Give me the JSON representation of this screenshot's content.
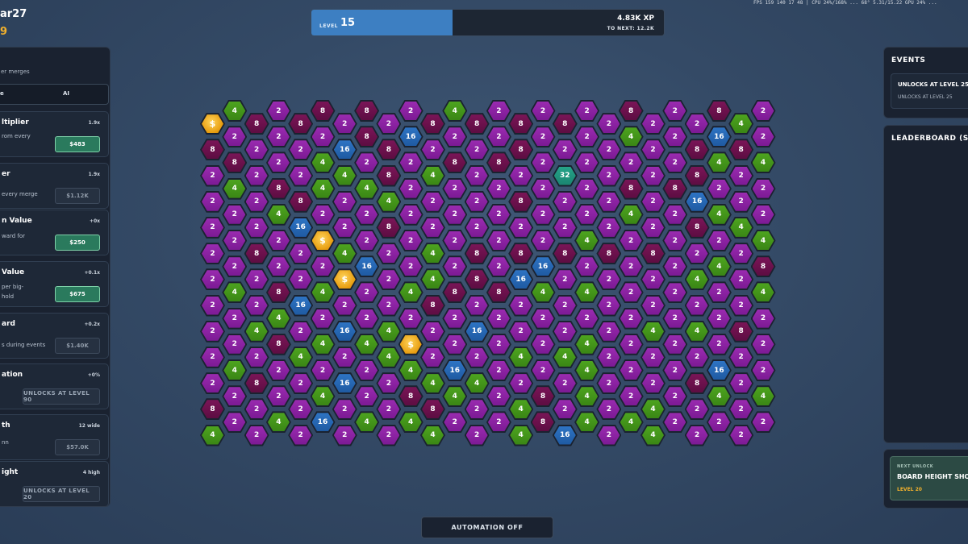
{
  "player": {
    "name": "ar27",
    "coins": "9"
  },
  "perf": "FPS 159 140 17 48  |  CPU 24%/168%  ...  68°  5.31/15.22  GPU 24%  ...",
  "level": {
    "label": "LEVEL",
    "value": "15",
    "xp": "4.83K XP",
    "to_next": "TO NEXT: 12.2K",
    "progress": 0.4
  },
  "left_panel": {
    "description": "er merges",
    "mode_tabs": [
      "e",
      "AI"
    ],
    "upgrades": [
      {
        "title": "ltiplier",
        "stat": "1.9x",
        "lines": [
          "rom every"
        ],
        "button": "$483",
        "affordable": true
      },
      {
        "title": "er",
        "stat": "1.9x",
        "lines": [
          "every merge"
        ],
        "button": "$1.12K",
        "affordable": false
      },
      {
        "title": "n Value",
        "stat": "+0x",
        "lines": [
          "ward for"
        ],
        "button": "$250",
        "affordable": true
      },
      {
        "title": "Value",
        "stat": "+0.1x",
        "lines": [
          "per big-",
          "hold"
        ],
        "button": "$675",
        "affordable": true
      },
      {
        "title": "ard",
        "stat": "+0.2x",
        "lines": [
          "s during events"
        ],
        "button": "$1.40K",
        "affordable": false
      },
      {
        "title": "ation",
        "stat": "+0%",
        "lines": [],
        "button": "UNLOCKS AT LEVEL 90",
        "locked": true
      },
      {
        "title": "th",
        "stat": "12 wide",
        "lines": [
          "nn"
        ],
        "button": "$57.0K",
        "affordable": false
      },
      {
        "title": "ight",
        "stat": "4 high",
        "lines": [],
        "button": "UNLOCKS AT LEVEL 20",
        "locked": true
      }
    ]
  },
  "events": {
    "title": "EVENTS",
    "card_title": "UNLOCKS AT LEVEL 25",
    "card_sub": "UNLOCKS AT LEVEL 25"
  },
  "leaderboard": {
    "title": "LEADERBOARD (SO"
  },
  "next_unlock": {
    "caption": "NEXT UNLOCK",
    "title": "BOARD HEIGHT SHO",
    "level": "LEVEL 20"
  },
  "automation": {
    "label": "AUTOMATION OFF"
  },
  "colors": {
    "tile_2": "#8a22a2",
    "tile_4": "#45961b",
    "tile_8": "#6a114c",
    "tile_16": "#2866b3",
    "tile_32": "#22957c",
    "coin": "#f0a81c",
    "accent_green": "#2a7a5d",
    "level_blue": "#3d7fc2"
  },
  "board": {
    "coin_symbol": "$",
    "rows": [
      [
        "4",
        "2",
        "8",
        "8",
        "2",
        "4",
        "2",
        "2",
        "2",
        "8",
        "2",
        "8",
        "2"
      ],
      [
        "C",
        "8",
        "8",
        "2",
        "2",
        "8",
        "8",
        "8",
        "8",
        "2",
        "2",
        "2",
        "4"
      ],
      [
        "2",
        "2",
        "2",
        "8",
        "16",
        "2",
        "2",
        "2",
        "2",
        "4",
        "2",
        "16",
        "2"
      ],
      [
        "8",
        "2",
        "2",
        "16",
        "8",
        "2",
        "2",
        "8",
        "2",
        "2",
        "2",
        "8",
        "8"
      ],
      [
        "8",
        "2",
        "4",
        "2",
        "2",
        "8",
        "8",
        "2",
        "2",
        "2",
        "2",
        "4",
        "4"
      ],
      [
        "2",
        "2",
        "2",
        "4",
        "8",
        "4",
        "2",
        "2",
        "32",
        "2",
        "2",
        "8",
        "2"
      ],
      [
        "4",
        "8",
        "4",
        "4",
        "2",
        "2",
        "2",
        "2",
        "2",
        "8",
        "8",
        "2",
        "2"
      ],
      [
        "2",
        "2",
        "8",
        "2",
        "4",
        "2",
        "2",
        "8",
        "2",
        "2",
        "2",
        "16",
        "2"
      ],
      [
        "2",
        "4",
        "2",
        "2",
        "2",
        "2",
        "2",
        "2",
        "2",
        "4",
        "2",
        "4",
        "2"
      ],
      [
        "2",
        "2",
        "16",
        "2",
        "8",
        "2",
        "2",
        "2",
        "2",
        "2",
        "2",
        "8",
        "4"
      ],
      [
        "2",
        "2",
        "C",
        "2",
        "2",
        "2",
        "2",
        "2",
        "4",
        "2",
        "2",
        "2",
        "4"
      ],
      [
        "2",
        "8",
        "2",
        "4",
        "2",
        "4",
        "8",
        "8",
        "8",
        "8",
        "8",
        "2",
        "2"
      ],
      [
        "2",
        "2",
        "2",
        "16",
        "2",
        "2",
        "2",
        "16",
        "2",
        "2",
        "2",
        "4",
        "8"
      ],
      [
        "2",
        "2",
        "2",
        "C",
        "2",
        "4",
        "8",
        "16",
        "2",
        "2",
        "2",
        "4",
        "2"
      ],
      [
        "4",
        "8",
        "4",
        "2",
        "4",
        "8",
        "8",
        "4",
        "4",
        "2",
        "2",
        "2",
        "4"
      ],
      [
        "2",
        "2",
        "16",
        "2",
        "2",
        "8",
        "2",
        "2",
        "2",
        "2",
        "2",
        "2",
        "2"
      ],
      [
        "2",
        "4",
        "2",
        "2",
        "2",
        "2",
        "2",
        "2",
        "2",
        "2",
        "2",
        "2",
        "2"
      ],
      [
        "2",
        "4",
        "2",
        "16",
        "4",
        "2",
        "16",
        "2",
        "2",
        "2",
        "4",
        "4",
        "8"
      ],
      [
        "2",
        "8",
        "4",
        "4",
        "C",
        "2",
        "2",
        "2",
        "4",
        "2",
        "2",
        "2",
        "2"
      ],
      [
        "2",
        "2",
        "4",
        "2",
        "4",
        "2",
        "2",
        "4",
        "4",
        "2",
        "2",
        "2",
        "2"
      ],
      [
        "4",
        "2",
        "2",
        "2",
        "4",
        "16",
        "2",
        "2",
        "4",
        "2",
        "2",
        "16",
        "2"
      ],
      [
        "2",
        "8",
        "2",
        "16",
        "2",
        "4",
        "4",
        "2",
        "2",
        "2",
        "2",
        "8",
        "2"
      ],
      [
        "2",
        "2",
        "4",
        "2",
        "8",
        "4",
        "2",
        "8",
        "4",
        "2",
        "2",
        "4",
        "4"
      ],
      [
        "8",
        "2",
        "2",
        "2",
        "2",
        "8",
        "2",
        "4",
        "2",
        "2",
        "4",
        "2",
        "2"
      ],
      [
        "2",
        "4",
        "16",
        "4",
        "4",
        "2",
        "2",
        "8",
        "4",
        "4",
        "2",
        "2",
        "2"
      ],
      [
        "4",
        "2",
        "2",
        "2",
        "2",
        "4",
        "2",
        "4",
        "16",
        "2",
        "4",
        "2",
        "2"
      ],
      [
        "2",
        "8",
        "4",
        "16",
        "2",
        "2",
        "2",
        "16",
        "2",
        "2",
        "2",
        "4",
        "4"
      ],
      [
        "2",
        "2",
        "2",
        "2",
        "4",
        "4",
        "2",
        "4",
        "2",
        "2",
        "2",
        "16",
        "2"
      ],
      [
        "4",
        "4",
        "4",
        "2",
        "8",
        "2",
        "2",
        "2",
        "2",
        "2",
        "2",
        "2",
        "2"
      ],
      [
        "4",
        "2",
        "2",
        "2",
        "4",
        "2",
        "2",
        "8",
        "8",
        "4",
        "2",
        "2",
        "4"
      ],
      [
        "2",
        "2",
        "2",
        "2",
        "2",
        "2",
        "2",
        "2",
        "2",
        "2",
        "2",
        "2",
        "2"
      ],
      [
        "2",
        "2",
        "2",
        "16",
        "2",
        "4",
        "2",
        "2",
        "4",
        "C",
        "2",
        "2",
        "2"
      ],
      [
        "4",
        "4",
        "4",
        "2",
        "2",
        "4",
        "2",
        "2",
        "2",
        "2",
        "8",
        "2",
        "2"
      ],
      [
        "8",
        "8",
        "2",
        "2",
        "2",
        "2",
        "4",
        "4",
        "2",
        "2",
        "2",
        "2",
        "2"
      ],
      [
        "8",
        "8",
        "2",
        "2",
        "2",
        "2",
        "2",
        "2",
        "16",
        "8",
        "2",
        "2",
        "2"
      ],
      [
        "2",
        "2",
        "2",
        "4",
        "4",
        "4",
        "4",
        "4",
        "4",
        "2",
        "2",
        "2",
        "2"
      ],
      [
        "2",
        "2",
        "2",
        "2",
        "2",
        "2",
        "2",
        "2",
        "2",
        "2",
        "2",
        "2",
        "2"
      ],
      [
        "2",
        "2",
        "2",
        "2",
        "4",
        "2",
        "2",
        "4",
        "2",
        "2",
        "2",
        "2",
        "2"
      ],
      [
        "2",
        "2",
        "2",
        "2",
        "2",
        "2",
        "2",
        "2",
        "2",
        "2",
        "2",
        "2",
        "2"
      ],
      [
        "2",
        "2",
        "2",
        "2",
        "2",
        "2",
        "2",
        "2",
        "2",
        "2",
        "2",
        "2",
        "2"
      ],
      [
        "2",
        "2",
        "2",
        "2",
        "2",
        "2",
        "2",
        "2",
        "2",
        "2",
        "2",
        "2",
        "2"
      ],
      [
        "2",
        "2",
        "2",
        "2",
        "2",
        "2",
        "2",
        "2",
        "2",
        "2",
        "2",
        "2",
        "2"
      ],
      [
        "2",
        "2",
        "2",
        "2",
        "2",
        "2",
        "2",
        "2",
        "2",
        "2",
        "2",
        "2",
        "2"
      ]
    ]
  }
}
